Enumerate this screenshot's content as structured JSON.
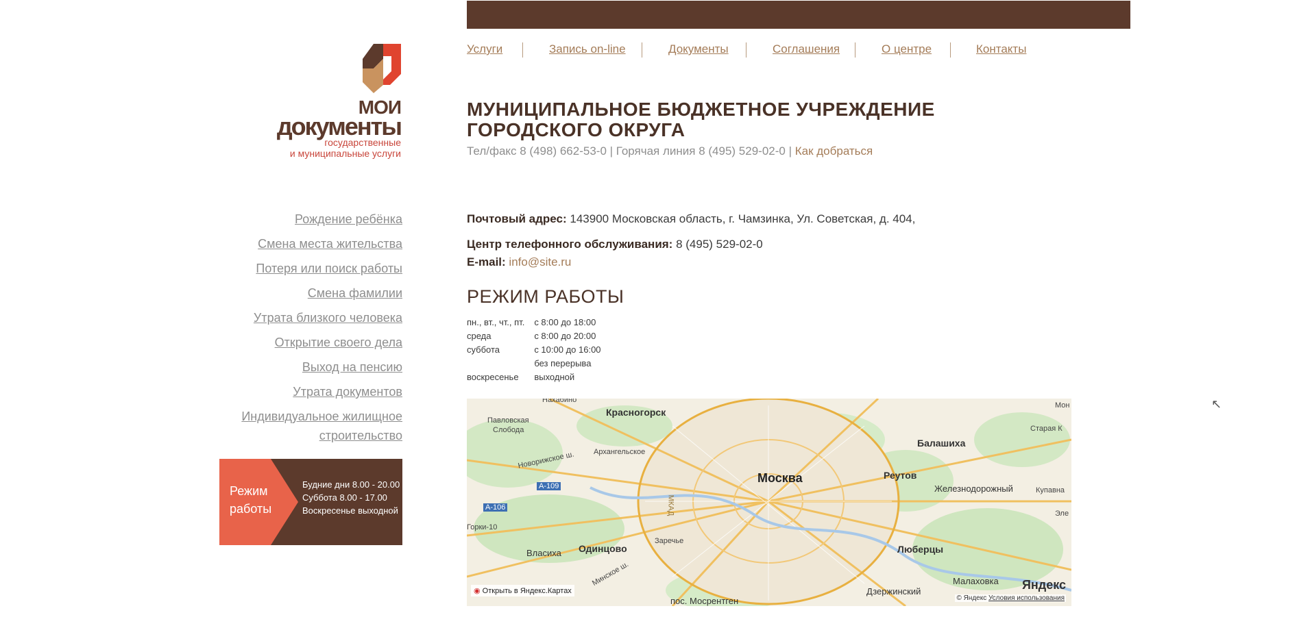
{
  "topnav": {
    "items": [
      "Услуги",
      "Запись on-line",
      "Документы",
      "Соглашения",
      "О центре",
      "Контакты"
    ]
  },
  "logo": {
    "line1": "МОИ",
    "line2": "документы",
    "line3": "государственные",
    "line4": "и муниципальные услуги",
    "colors": {
      "brown": "#5c3a2c",
      "red": "#e0442f",
      "tan": "#c9935f"
    }
  },
  "header": {
    "title_line1": "МУНИЦИПАЛЬНОЕ БЮДЖЕТНОЕ УЧРЕЖДЕНИЕ",
    "title_line2": "ГОРОДСКОГО ОКРУГА",
    "contacts": "Тел/факс 8 (498) 662-53-0 | Горячая линия 8 (495) 529-02-0 |",
    "directions_link": "Как добраться"
  },
  "sidenav": {
    "items": [
      "Рождение ребёнка",
      "Смена места жительства",
      "Потеря или поиск работы",
      "Смена фамилии",
      "Утрата близкого человека",
      "Открытие своего дела",
      "Выход на пенсию",
      "Утрата документов",
      "Индивидуальное жилищное строительство"
    ]
  },
  "promo": {
    "label_line1": "Режим",
    "label_line2": "работы",
    "lines": [
      "Будние дни 8.00 - 20.00",
      "Суббота 8.00 - 17.00",
      "Воскресенье выходной"
    ],
    "colors": {
      "left": "#e8634a",
      "right": "#5c3a2c"
    }
  },
  "info": {
    "address_label": "Почтовый адрес:",
    "address_value": "143900 Московская область, г. Чамзинка, Ул. Советская, д. 404,",
    "phone_label": "Центр телефонного обслуживания:",
    "phone_value": "8 (495) 529-02-0",
    "email_label": "E-mail:",
    "email_value": "info@site.ru"
  },
  "schedule": {
    "heading": "РЕЖИМ РАБОТЫ",
    "rows": [
      {
        "day": "пн., вт., чт., пт.",
        "time": "с 8:00 до 18:00"
      },
      {
        "day": "среда",
        "time": "с 8:00 до 20:00"
      },
      {
        "day": "суббота",
        "time": "с 10:00 до 16:00"
      },
      {
        "day": "",
        "time": "без перерыва"
      },
      {
        "day": "воскресенье",
        "time": "выходной"
      }
    ]
  },
  "map": {
    "labels": {
      "moscow": "Москва",
      "krasnogorsk": "Красногорск",
      "balashikha": "Балашиха",
      "reutov": "Реутов",
      "zheleznodorozhny": "Железнодорожный",
      "lyubertsy": "Люберцы",
      "odintsovo": "Одинцово",
      "vlasikha": "Власиха",
      "dzerzhinsky": "Дзержинский",
      "malakhovka": "Малаховка",
      "mosrentgen": "пос. Мосрентген",
      "arkhangelskoe": "Архангельское",
      "pavlovskaya": "Павловская",
      "sloboda": "Слобода",
      "zarechye": "Заречье",
      "novorizhskoe": "Новорижское ш.",
      "kupavna": "Купавна",
      "staraya": "Старая К",
      "mon": "Мон",
      "ele": "Эле",
      "gorki": "Горки-10",
      "nakhabino": "Нахабино",
      "mkad": "МКАД",
      "a106": "А-106",
      "a109": "А-109",
      "minskoe": "Минское ш."
    },
    "open_link": "Открыть в Яндекс.Картах",
    "brand": "Яндекс",
    "copyright": "© Яндекс",
    "terms": "Условия использования"
  }
}
